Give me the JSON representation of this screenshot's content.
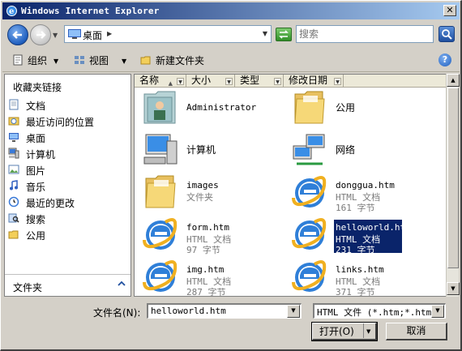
{
  "window": {
    "title": "Windows Internet Explorer",
    "close_glyph": "✕"
  },
  "address": {
    "location": "桌面",
    "search_placeholder": "搜索"
  },
  "toolbar": {
    "organize": "组织",
    "views": "视图",
    "new_folder": "新建文件夹",
    "help": "?"
  },
  "sidebar": {
    "header": "收藏夹链接",
    "items": [
      {
        "label": "文档",
        "icon": "documents-icon"
      },
      {
        "label": "最近访问的位置",
        "icon": "recent-places-icon"
      },
      {
        "label": "桌面",
        "icon": "desktop-icon"
      },
      {
        "label": "计算机",
        "icon": "computer-icon"
      },
      {
        "label": "图片",
        "icon": "pictures-icon"
      },
      {
        "label": "音乐",
        "icon": "music-icon"
      },
      {
        "label": "最近的更改",
        "icon": "recent-changes-icon"
      },
      {
        "label": "搜索",
        "icon": "search-folder-icon"
      },
      {
        "label": "公用",
        "icon": "public-folder-icon"
      }
    ],
    "folders_label": "文件夹"
  },
  "columns": [
    "名称",
    "大小",
    "类型",
    "修改日期"
  ],
  "files": [
    {
      "name": "Administrator",
      "type": "",
      "size": "",
      "icon": "user-folder-icon"
    },
    {
      "name": "公用",
      "type": "",
      "size": "",
      "icon": "folder-icon"
    },
    {
      "name": "计算机",
      "type": "",
      "size": "",
      "icon": "computer-icon"
    },
    {
      "name": "网络",
      "type": "",
      "size": "",
      "icon": "network-icon"
    },
    {
      "name": "images",
      "type": "文件夹",
      "size": "",
      "icon": "folder-icon"
    },
    {
      "name": "donggua.htm",
      "type": "HTML 文档",
      "size": "161 字节",
      "icon": "ie-html-icon"
    },
    {
      "name": "form.htm",
      "type": "HTML 文档",
      "size": "97 字节",
      "icon": "ie-html-icon"
    },
    {
      "name": "helloworld.htm",
      "type": "HTML 文档",
      "size": "231 字节",
      "icon": "ie-html-icon",
      "selected": true
    },
    {
      "name": "img.htm",
      "type": "HTML 文档",
      "size": "287 字节",
      "icon": "ie-html-icon"
    },
    {
      "name": "links.htm",
      "type": "HTML 文档",
      "size": "371 字节",
      "icon": "ie-html-icon"
    }
  ],
  "footer": {
    "filename_label": "文件名(N):",
    "filename_value": "helloworld.htm",
    "filetype_value": "HTML 文件 (*.htm;*.html;",
    "open_label": "打开(O)",
    "cancel_label": "取消"
  }
}
